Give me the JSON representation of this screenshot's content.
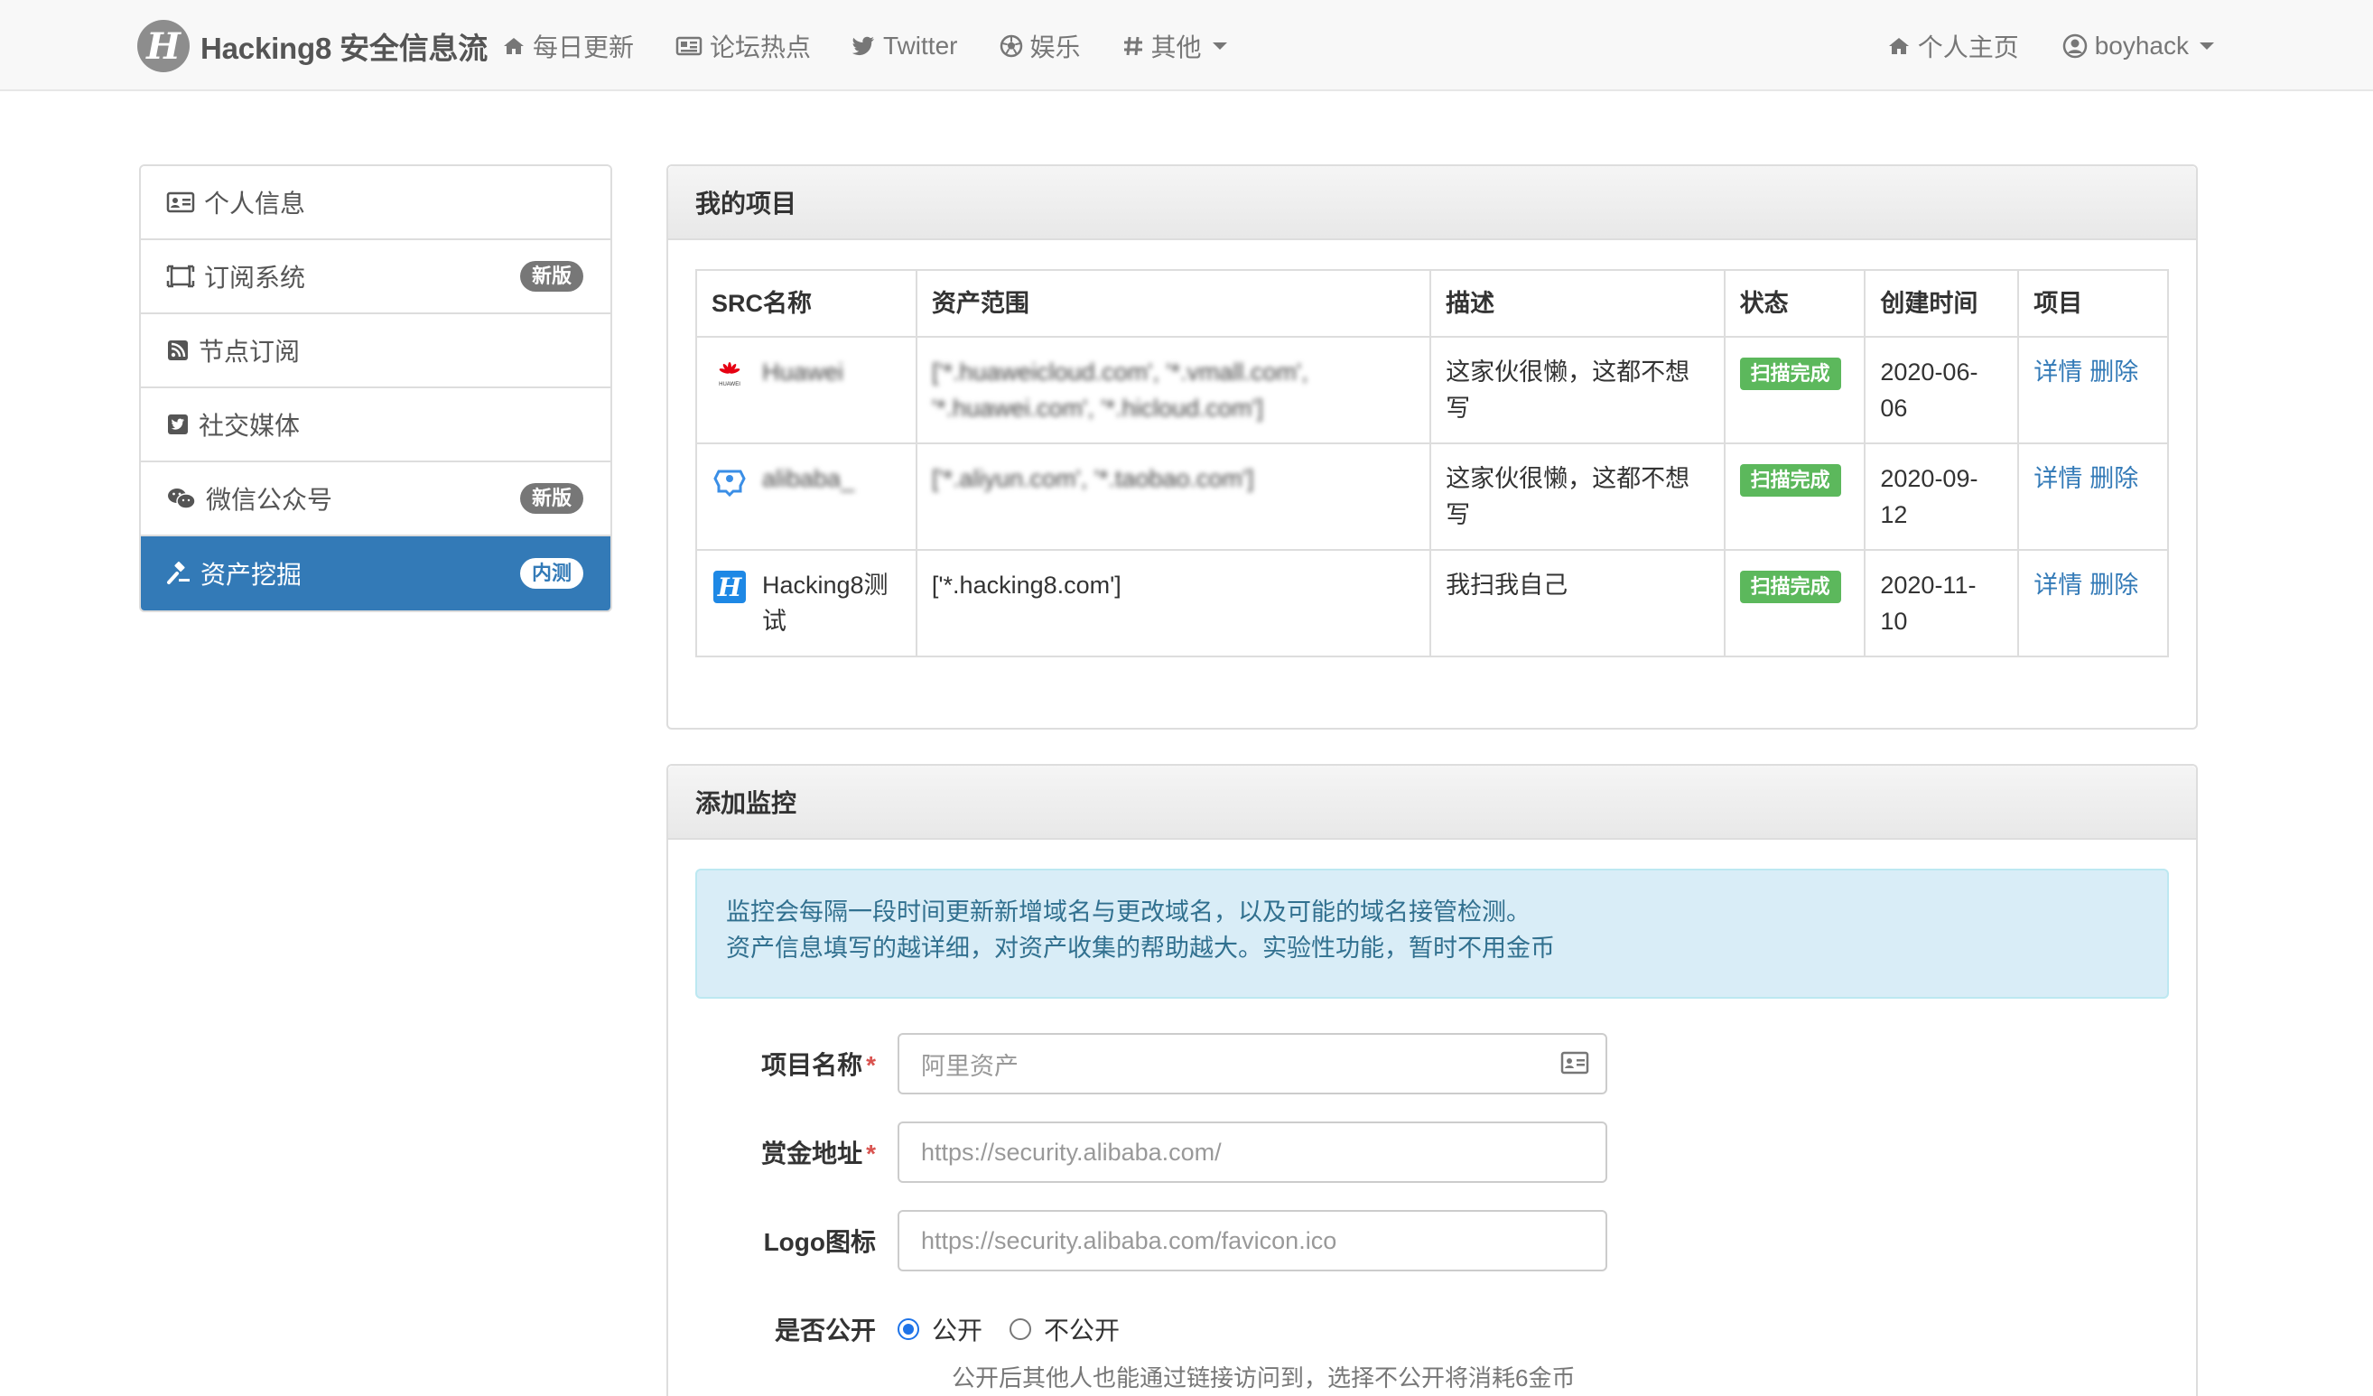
{
  "navbar": {
    "brand_logo_letter": "H",
    "brand": "Hacking8 安全信息流",
    "left_items": [
      {
        "label": "每日更新",
        "icon": "home-icon"
      },
      {
        "label": "论坛热点",
        "icon": "newspaper-icon"
      },
      {
        "label": "Twitter",
        "icon": "twitter-icon"
      },
      {
        "label": "娱乐",
        "icon": "soccer-ball-icon"
      },
      {
        "label": "其他",
        "icon": "hashtag-icon"
      }
    ],
    "right_items": [
      {
        "label": "个人主页",
        "icon": "home-icon"
      },
      {
        "label": "boyhack",
        "icon": "user-circle-icon"
      }
    ]
  },
  "sidebar": {
    "items": [
      {
        "label": "个人信息",
        "icon": "id-card-icon",
        "badge": ""
      },
      {
        "label": "订阅系统",
        "icon": "frame-icon",
        "badge": "新版"
      },
      {
        "label": "节点订阅",
        "icon": "rss-icon",
        "badge": ""
      },
      {
        "label": "社交媒体",
        "icon": "twitter-square-icon",
        "badge": ""
      },
      {
        "label": "微信公众号",
        "icon": "wechat-icon",
        "badge": "新版"
      },
      {
        "label": "资产挖掘",
        "icon": "gavel-icon",
        "badge": "内测",
        "active": true
      }
    ]
  },
  "projects": {
    "title": "我的项目",
    "columns": [
      "SRC名称",
      "资产范围",
      "描述",
      "状态",
      "创建时间",
      "项目"
    ],
    "rows": [
      {
        "name": "Huawei",
        "logo": "huawei-logo-icon",
        "scope": "['*.huaweicloud.com', '*.vmall.com', '*.huawei.com', '*.hicloud.com']",
        "desc": "这家伙很懒，这都不想写",
        "status": "扫描完成",
        "created": "2020-06-06",
        "actions": [
          "详情",
          "删除"
        ]
      },
      {
        "name": "alibaba_",
        "logo": "alibaba-logo-icon",
        "scope": "['*.aliyun.com', '*.taobao.com']",
        "desc": "这家伙很懒，这都不想写",
        "status": "扫描完成",
        "created": "2020-09-12",
        "actions": [
          "详情",
          "删除"
        ]
      },
      {
        "name": "Hacking8测试",
        "logo": "hacking8-logo-icon",
        "scope": "['*.hacking8.com']",
        "desc": "我扫我自己",
        "status": "扫描完成",
        "created": "2020-11-10",
        "actions": [
          "详情",
          "删除"
        ]
      }
    ]
  },
  "monitor": {
    "title": "添加监控",
    "alert_line1": "监控会每隔一段时间更新新增域名与更改域名，以及可能的域名接管检测。",
    "alert_line2": "资产信息填写的越详细，对资产收集的帮助越大。实验性功能，暂时不用金币",
    "fields": [
      {
        "label": "项目名称",
        "required": "*",
        "placeholder": "阿里资产"
      },
      {
        "label": "赏金地址",
        "required": "*",
        "placeholder": "https://security.alibaba.com/"
      },
      {
        "label": "Logo图标",
        "required": "",
        "placeholder": "https://security.alibaba.com/favicon.ico"
      }
    ],
    "public_label": "是否公开",
    "public_options": [
      "公开",
      "不公开"
    ],
    "public_selected": "公开",
    "public_help": "公开后其他人也能通过链接访问到，选择不公开将消耗6金币"
  },
  "colors": {
    "primary": "#337ab7",
    "success": "#5cb85c",
    "alert_bg": "#d9edf7",
    "alert_text": "#31708f"
  }
}
